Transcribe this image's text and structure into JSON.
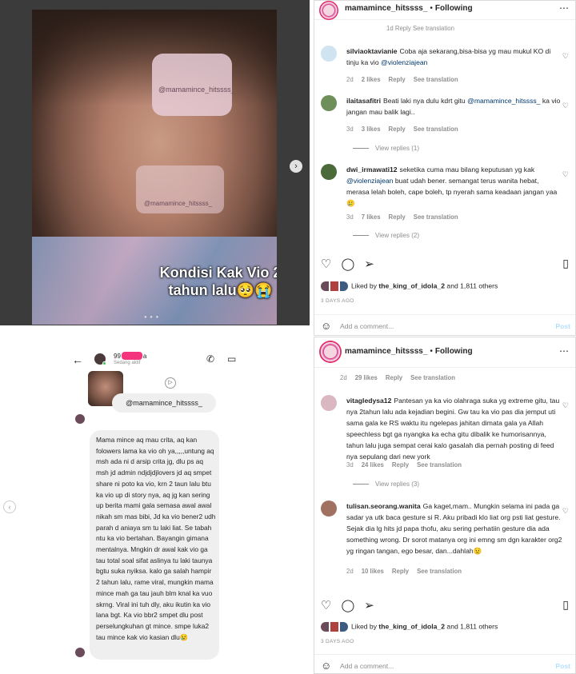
{
  "photo_post": {
    "caption": "Kondisi Kak Vio 2 tahun lalu🥺😭",
    "sticker_tag": "@mamamince_hitssss_",
    "next_glyph": "›",
    "dots": "● ● ●"
  },
  "panel1": {
    "username": "mamamince_hitssss_",
    "dot": "•",
    "follow_label": "Following",
    "more": "⋯",
    "top_meta": "1d   Reply   See translation",
    "comments": [
      {
        "user": "silviaoktavianie",
        "text": "Coba aja sekarang,bisa-bisa yg mau mukul KO di tinju ka vio",
        "mention": "@violenziajean",
        "time": "2d",
        "likes": "2 likes",
        "reply": "Reply",
        "translate": "See translation"
      },
      {
        "user": "ilaitasafitri",
        "text": "Beati laki nya dulu kdrt gitu",
        "mention": "@mamamince_hitssss_",
        "text2": "ka vio jangan mau balik lagi..",
        "time": "3d",
        "likes": "3 likes",
        "reply": "Reply",
        "translate": "See translation",
        "view_replies": "View replies (1)"
      },
      {
        "user": "dwi_irmawati12",
        "text": "seketika cuma mau bilang keputusan yg kak",
        "mention": "@violenziajean",
        "text2": "buat udah bener. semangat terus wanita hebat, merasa lelah boleh, cape boleh, tp nyerah sama keadaan jangan yaa 🥲",
        "time": "3d",
        "likes": "7 likes",
        "reply": "Reply",
        "translate": "See translation",
        "view_replies": "View replies (2)"
      }
    ],
    "liked_by_prefix": "Liked by",
    "liked_by_user": "the_king_of_idola_2",
    "liked_by_suffix": "and 1,811 others",
    "ago": "3 DAYS AGO",
    "add_comment_placeholder": "Add a comment...",
    "post_label": "Post"
  },
  "panel2": {
    "username": "mamamince_hitssss_",
    "dot": "•",
    "follow_label": "Following",
    "more": "⋯",
    "top_meta": {
      "time": "2d",
      "likes": "29 likes",
      "reply": "Reply",
      "translate": "See translation"
    },
    "comments": [
      {
        "user": "vitagledysa12",
        "text": "Pantesan ya ka vio olahraga suka yg extreme gitu, tau nya 2tahun lalu ada kejadian begini. Gw tau ka vio pas dia jemput uti sama gala ke RS waktu itu ngelepas jahitan dimata gala ya Allah speechless bgt ga nyangka ka echa gitu dibalik ke humorisannya, tahun lalu juga sempat cerai kalo gasalah dia pernah posting di feed nya sepulang dari new york",
        "time": "3d",
        "likes": "24 likes",
        "reply": "Reply",
        "translate": "See translation",
        "view_replies": "View replies (3)"
      },
      {
        "user": "tulisan.seorang.wanita",
        "text": "Ga kaget,mam.. Mungkin selama ini pada ga sadar ya utk baca gesture si R. Aku pribadi klo liat org psti liat gesture. Sejak dia lg hits jd papa thofu, aku sering perhatiin gesture dia ada something wrong. Dr sorot matanya org ini emng sm dgn karakter org2 yg ringan tangan, ego besar, dan...dahlah😟",
        "time": "2d",
        "likes": "10 likes",
        "reply": "Reply",
        "translate": "See translation"
      }
    ],
    "liked_by_prefix": "Liked by",
    "liked_by_user": "the_king_of_idola_2",
    "liked_by_suffix": "and 1,811 others",
    "ago": "3 DAYS AGO",
    "add_comment_placeholder": "Add a comment...",
    "post_label": "Post"
  },
  "dm": {
    "back": "←",
    "name_prefix": "99",
    "name_suffix": "a",
    "status": "Sedang aktif",
    "call_icon": "✆",
    "video_icon": "▭",
    "mention_bubble": "@mamamince_hitssss_",
    "play_glyph": "▷",
    "message": "Mama mince aq mau crita, aq kan folowers lama ka vio oh ya,,,,,untung aq msh ada ni d arsip crita jg, dlu ps aq msh jd admin ndjdjdjlovers jd aq smpet share ni poto ka vio, krn 2 taun lalu btu ka vio up di story nya, aq jg kan sering up berita mami gala semasa awal awal nikah sm mas bibi, Jd ka vio bener2 udh parah d aniaya sm tu laki liat. Se tabah ntu ka vio bertahan. Bayangin gimana mentalnya. Mngkin dr awal kak vio ga tau total soal sifat aslinya tu laki taunya bgtu suka nyiksa. kalo ga salah hampir 2 tahun lalu, rame viral, mungkin mama mince mah ga tau jauh blm knal ka vuo skrng. Viral ini tuh dly, aku ikutin ka vio lana bgt. Ka vio bbr2 smpet dlu post perselungkuhan gt mince. smpe luka2 tau mince kak vio kasian dlu😢",
    "scroll_glyph": "‹"
  }
}
